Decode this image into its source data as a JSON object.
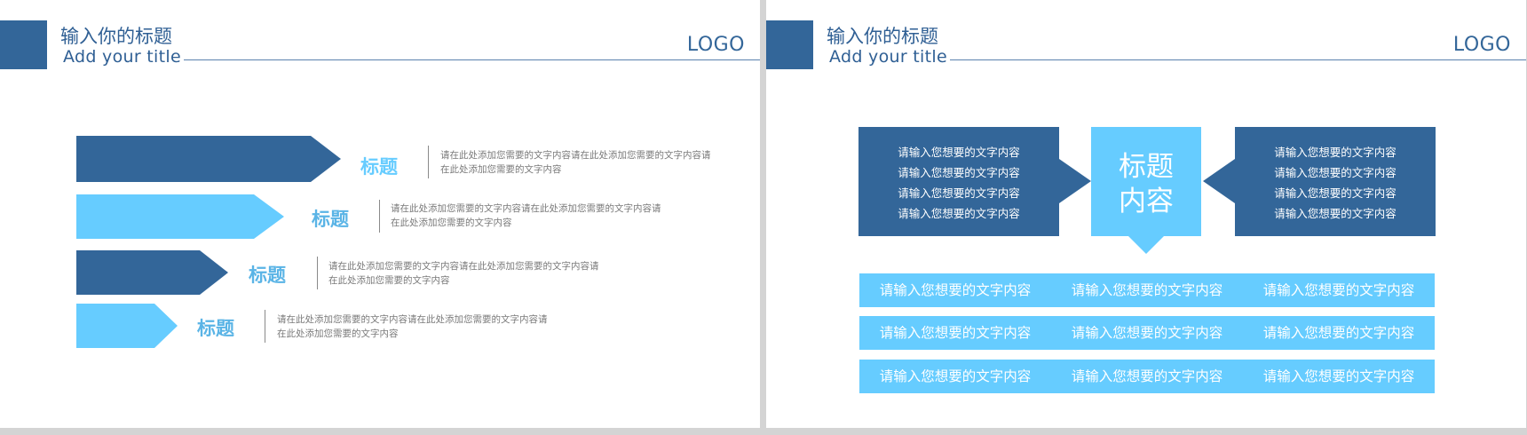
{
  "colors": {
    "dark_blue": "#336699",
    "light_blue": "#66ccff",
    "background": "#ffffff",
    "frame": "#d4d4d4",
    "body_text": "#7a7a7a"
  },
  "slide_left": {
    "header": {
      "title_cn": "输入你的标题",
      "title_en": "Add your title",
      "logo": "LOGO"
    },
    "rows": [
      {
        "title": "标题",
        "color": "#336699",
        "text": "请在此处添加您需要的文字内容请在此处添加您需要的文字内容请在此处添加您需要的文字内容"
      },
      {
        "title": "标题",
        "color": "#66ccff",
        "text": "请在此处添加您需要的文字内容请在此处添加您需要的文字内容请在此处添加您需要的文字内容"
      },
      {
        "title": "标题",
        "color": "#66ccff",
        "text": "请在此处添加您需要的文字内容请在此处添加您需要的文字内容请在此处添加您需要的文字内容"
      },
      {
        "title": "标题",
        "color": "#66ccff",
        "text": "请在此处添加您需要的文字内容请在此处添加您需要的文字内容请在此处添加您需要的文字内容"
      }
    ]
  },
  "slide_right": {
    "header": {
      "title_cn": "输入你的标题",
      "title_en": "Add your title",
      "logo": "LOGO"
    },
    "center_title": "标题\n内容",
    "left_block": [
      "请输入您想要的文字内容",
      "请输入您想要的文字内容",
      "请输入您想要的文字内容",
      "请输入您想要的文字内容"
    ],
    "right_block": [
      "请输入您想要的文字内容",
      "请输入您想要的文字内容",
      "请输入您想要的文字内容",
      "请输入您想要的文字内容"
    ],
    "strips": [
      [
        "请输入您想要的文字内容",
        "请输入您想要的文字内容",
        "请输入您想要的文字内容"
      ],
      [
        "请输入您想要的文字内容",
        "请输入您想要的文字内容",
        "请输入您想要的文字内容"
      ],
      [
        "请输入您想要的文字内容",
        "请输入您想要的文字内容",
        "请输入您想要的文字内容"
      ]
    ]
  }
}
